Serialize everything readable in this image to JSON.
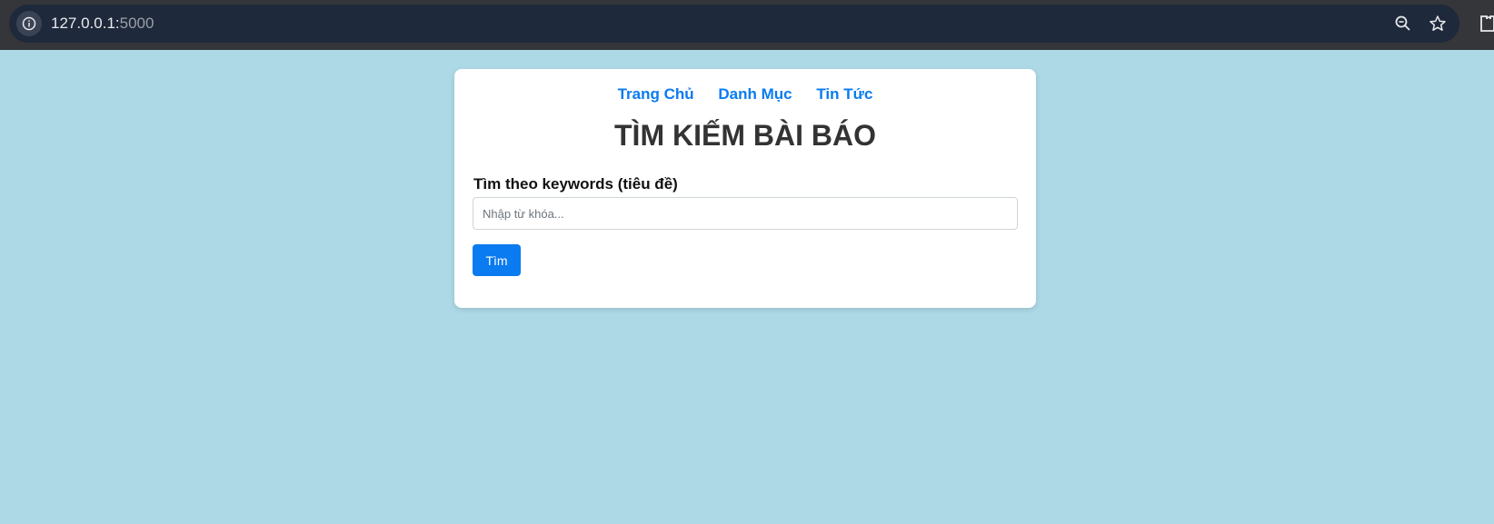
{
  "browser": {
    "url_host": "127.0.0.1:",
    "url_port": "5000",
    "icons": [
      "info-icon",
      "zoom-out-icon",
      "star-icon",
      "extensions-icon"
    ]
  },
  "nav": {
    "items": [
      "Trang Chủ",
      "Danh Mục",
      "Tin Tức"
    ]
  },
  "page": {
    "title": "TÌM KIẾM BÀI BÁO",
    "search_label": "Tìm theo keywords (tiêu đề)",
    "search_placeholder": "Nhập từ khóa...",
    "search_value": "",
    "search_button": "Tìm"
  },
  "colors": {
    "background": "#add8e6",
    "link": "#0a7bf0",
    "button": "#0a7bf0",
    "title": "#333333"
  }
}
